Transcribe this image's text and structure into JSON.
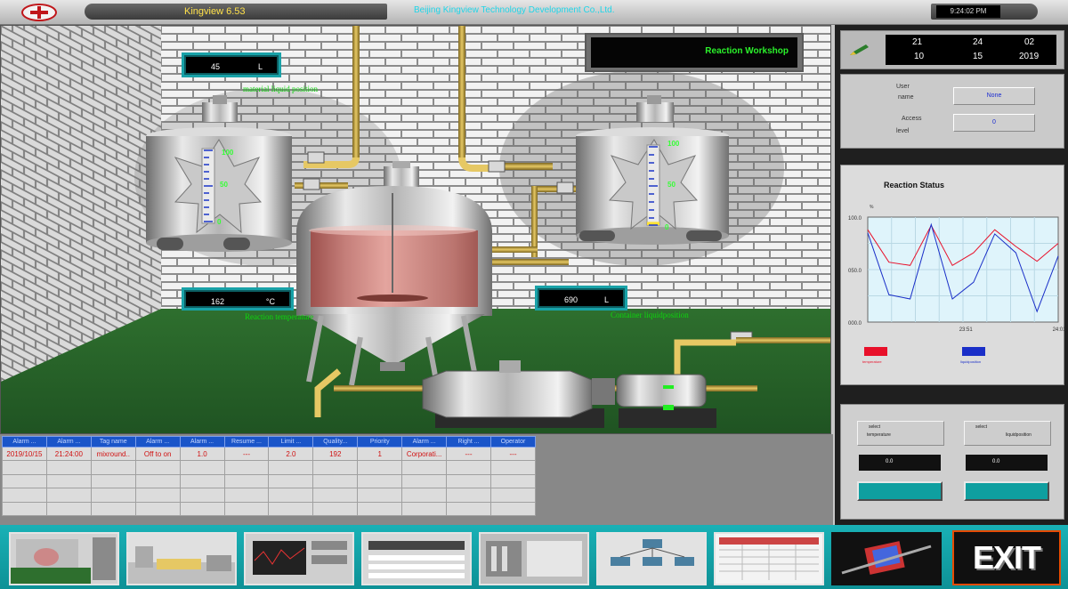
{
  "title_bar": {
    "app_title": "Kingview 6.53",
    "company": "Beijing Kingview Technology Development Co.,Ltd.",
    "clock": "9:24:02 PM"
  },
  "workshop_label": "Reaction Workshop",
  "tanks": {
    "left_scale": [
      "100",
      "50",
      "0"
    ],
    "right_scale": [
      "100",
      "50",
      "0"
    ],
    "left_level_percent": 0,
    "right_level_percent": 4
  },
  "displays": {
    "material": {
      "value": "45",
      "unit": "L",
      "caption": "material liquid position"
    },
    "temperature": {
      "value": "162",
      "unit": "°C",
      "caption": "Reaction temperature"
    },
    "container": {
      "value": "690",
      "unit": "L",
      "caption": "Container liquidposition"
    }
  },
  "clock_panel": {
    "hour": "21",
    "minute": "24",
    "second": "02",
    "month": "10",
    "day": "15",
    "year": "2019"
  },
  "user_panel": {
    "user_label": "User",
    "name_label": "name",
    "access_label": "Access",
    "level_label": "level",
    "user_value": "None",
    "access_value": "0"
  },
  "chart_data": {
    "type": "line",
    "title": "Reaction Status",
    "ylabel": "%",
    "y_ticks": [
      "100.0",
      "050.0",
      "000.0"
    ],
    "x_ticks": [
      "23:51",
      "24:01"
    ],
    "ylim": [
      0,
      100
    ],
    "series": [
      {
        "name": "temperature",
        "color": "#e8102a",
        "values": [
          88,
          57,
          54,
          92,
          54,
          66,
          88,
          72,
          58,
          75
        ]
      },
      {
        "name": "liquidposition",
        "color": "#1a2fc8",
        "values": [
          85,
          26,
          22,
          93,
          22,
          38,
          84,
          66,
          10,
          63
        ]
      }
    ]
  },
  "control_panel": {
    "left": {
      "select_title": "select",
      "select_value": "temperature",
      "display": "0.0"
    },
    "right": {
      "select_title": "select",
      "select_value": "liquidposition",
      "display": "0.0"
    }
  },
  "alarm_table": {
    "headers": [
      "Alarm ...",
      "Alarm ...",
      "Tag name",
      "Alarm ...",
      "Alarm ...",
      "Resume ...",
      "Limit ...",
      "Quality...",
      "Priority",
      "Alarm ...",
      "Right ...",
      "Operator"
    ],
    "rows": [
      [
        "2019/10/15",
        "21:24:00",
        "mixround..",
        "Off to on",
        "1.0",
        "---",
        "2.0",
        "192",
        "1",
        "Corporati...",
        "---",
        "---"
      ]
    ]
  },
  "nav": {
    "exit_label": "EXIT"
  },
  "colors": {
    "accent": "#18a2a8",
    "alarm_header": "#1a55c9",
    "alarm_text": "#d01010",
    "caption_green": "#0ed50e"
  }
}
